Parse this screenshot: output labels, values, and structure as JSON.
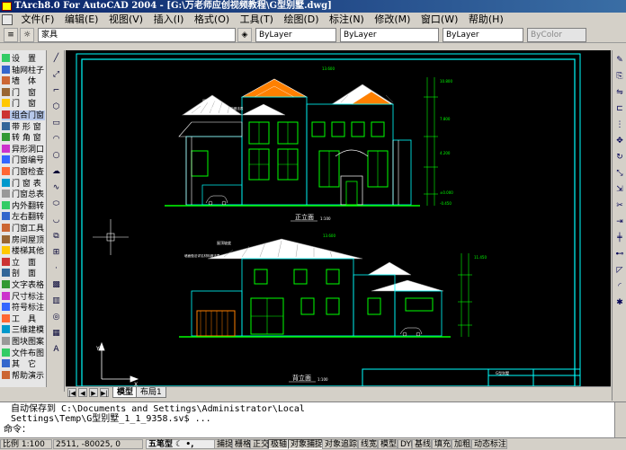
{
  "titlebar": {
    "text": "TArch8.0 For AutoCAD 2004 - [G:\\万老师应创视频教程\\G型别墅.dwg]"
  },
  "menu": [
    "文件(F)",
    "编辑(E)",
    "视图(V)",
    "插入(I)",
    "格式(O)",
    "工具(T)",
    "绘图(D)",
    "标注(N)",
    "修改(M)",
    "窗口(W)",
    "帮助(H)"
  ],
  "layer": {
    "name": "家具",
    "color": "ByLayer",
    "linetype": "ByLayer",
    "lineweight": "ByLayer",
    "plotstyle": "ByColor"
  },
  "sidebar": {
    "items": [
      "设　置",
      "轴网柱子",
      "墙　体",
      "门　窗",
      "门　窗",
      "组合门窗",
      "带 形 窗",
      "转 角 窗",
      "异形洞口",
      "门窗编号",
      "门窗检查",
      "门 窗 表",
      "门窗总表",
      "内外翻转",
      "左右翻转",
      "门窗工具",
      "房间屋顶",
      "楼梯其他",
      "立　面",
      "剖　面",
      "文字表格",
      "尺寸标注",
      "符号标注",
      "工　具",
      "三维建模",
      "图块图案",
      "文件布图",
      "其　它",
      "帮助演示"
    ]
  },
  "drawing": {
    "front_label": "正立面",
    "front_scale": "1:100",
    "back_label": "背立面",
    "back_scale": "1:100",
    "tag1": "屋顶坡度",
    "tag2": "墙面做法详见材料做法表",
    "tag3": "屋顶坡度",
    "tag4": "墙面做法详见材料做法表",
    "elev_top": "13.600",
    "elev_b": "10.800",
    "elev_c": "7.800",
    "elev_d": "4.200",
    "elev_e": "±0.000",
    "elev_f": "-0.450",
    "elev_g": "13.600",
    "elev_h": "11.450"
  },
  "tabs": {
    "model": "模型",
    "layout": "布局1"
  },
  "command": {
    "line1": "自动保存到 C:\\Documents and Settings\\Administrator\\Local",
    "line2": "Settings\\Temp\\G型别墅_1_1_9358.sv$ ...",
    "prompt": "命令："
  },
  "status": {
    "scale": "比例 1:100",
    "coords": "2511,  -80025, 0",
    "ime": "五笔型",
    "toggles": [
      "捕捉",
      "栅格",
      "正交",
      "极轴",
      "对象捕捉",
      "对象追踪",
      "线宽",
      "模型",
      "DYN",
      "基线",
      "填充",
      "加粗",
      "动态标注"
    ]
  },
  "colors": {
    "canvas": "#000000",
    "cyan": "#00ffff",
    "green": "#00ff00",
    "orange": "#ff8000",
    "frame": "#00ffff"
  }
}
